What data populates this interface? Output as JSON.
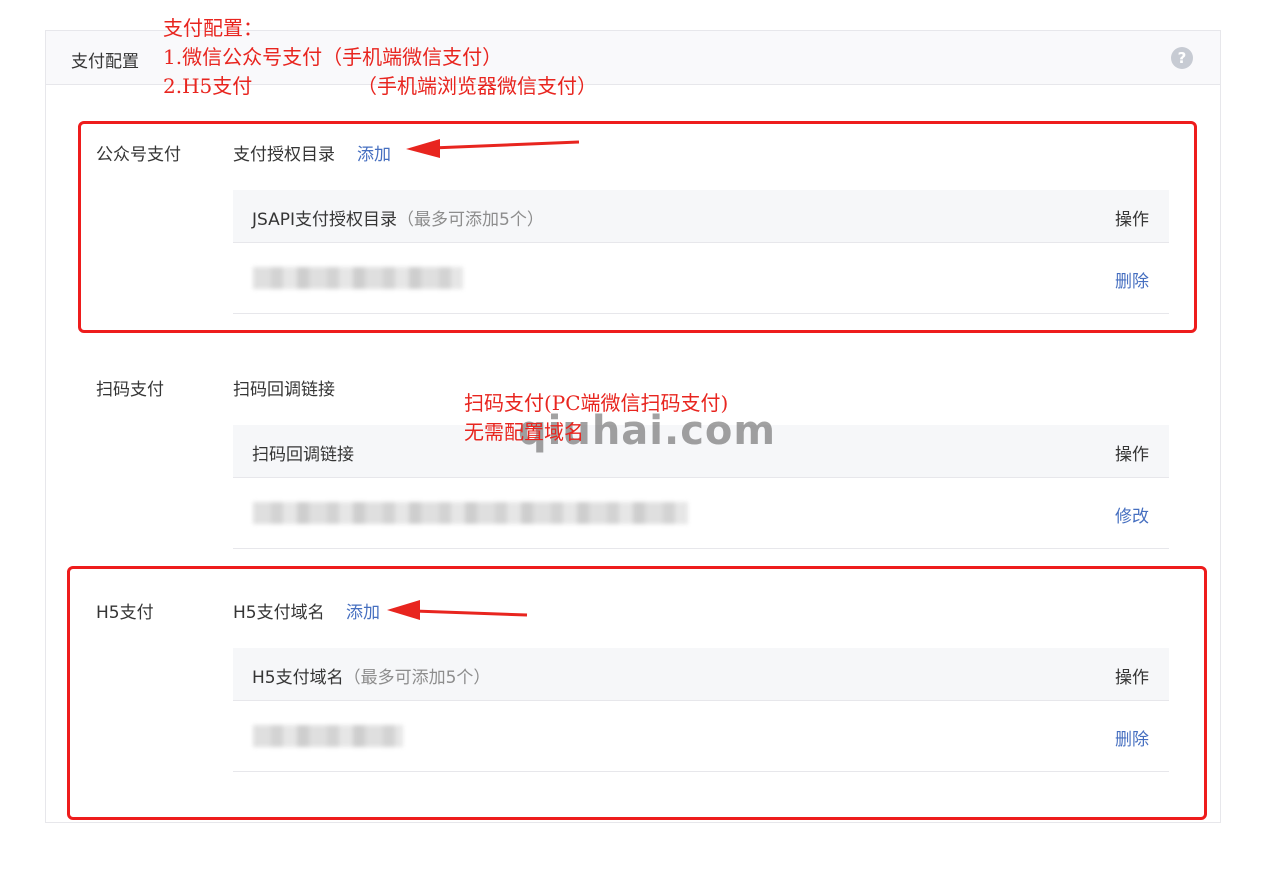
{
  "header": {
    "title": "支付配置",
    "help_icon": "question-circle-icon"
  },
  "annotation_top": {
    "line1": "支付配置：",
    "line2": "1.微信公众号支付（手机端微信支付）",
    "line3": "2.H5支付",
    "line3b": "（手机端浏览器微信支付）"
  },
  "jsapi": {
    "section_label": "公众号支付",
    "sub_label": "支付授权目录",
    "add_label": "添加",
    "table_header": "JSAPI支付授权目录",
    "table_hint": "（最多可添加5个）",
    "op_header": "操作",
    "row_action": "删除"
  },
  "native": {
    "section_label": "扫码支付",
    "sub_label": "扫码回调链接",
    "table_header": "扫码回调链接",
    "op_header": "操作",
    "row_action": "修改"
  },
  "annotation_mid": {
    "line1": "扫码支付(PC端微信扫码支付)",
    "line2": "无需配置域名"
  },
  "watermark": "qiuhai.com",
  "h5": {
    "section_label": "H5支付",
    "sub_label": "H5支付域名",
    "add_label": "添加",
    "table_header": "H5支付域名",
    "table_hint": "（最多可添加5个）",
    "op_header": "操作",
    "row_action": "删除"
  },
  "colors": {
    "accent_link": "#466fc0",
    "annotation_red": "#e8251f",
    "header_bg": "#f9f9fb",
    "table_head_bg": "#f6f7f9"
  }
}
